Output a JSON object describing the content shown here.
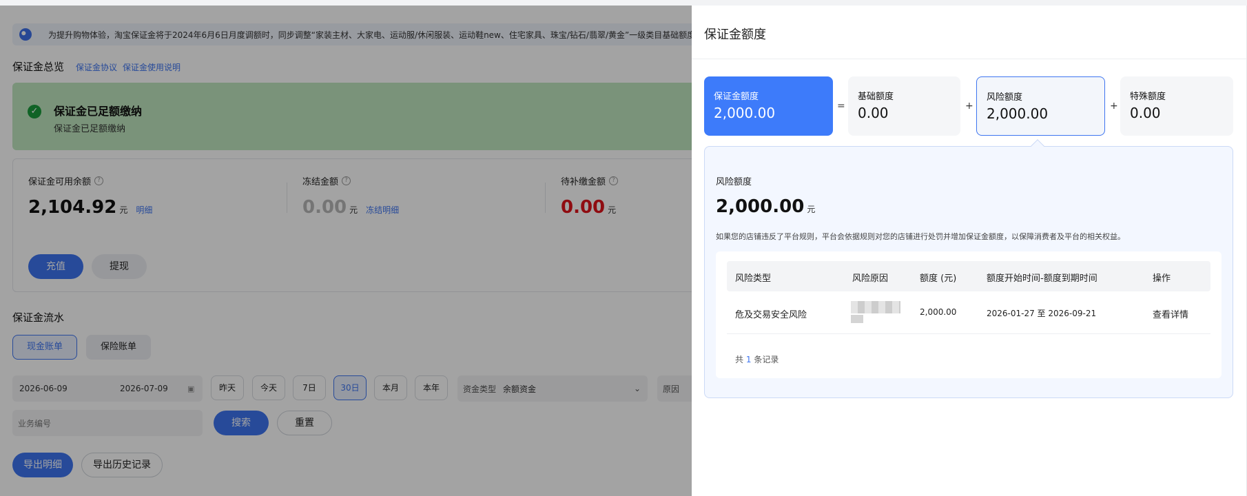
{
  "notice": {
    "text": "为提升购物体验，淘宝保证金将于2024年6月6日月度调额时，同步调整“家装主材、大家电、运动服/休闲服装、运动鞋new、住宅家具、珠宝/钻石/翡翠/黄金”一级类目基础额度，"
  },
  "overview": {
    "title": "保证金总览",
    "links": [
      "保证金协议",
      "保证金使用说明"
    ]
  },
  "status": {
    "title": "保证金已足额缴纳",
    "subtitle": "保证金已足额缴纳"
  },
  "balances": [
    {
      "label": "保证金可用余额",
      "value": "2,104.92",
      "unit": "元",
      "link": "明细",
      "color": "#111111"
    },
    {
      "label": "冻结金额",
      "value": "0.00",
      "unit": "元",
      "link": "冻结明细",
      "color": "#b8b8b8"
    },
    {
      "label": "待补缴金额",
      "value": "0.00",
      "unit": "元",
      "link": "",
      "color": "#e0141c"
    }
  ],
  "balance_actions": {
    "recharge": "充值",
    "withdraw": "提现"
  },
  "flow": {
    "title": "保证金流水",
    "tabs": [
      "现金账单",
      "保险账单"
    ],
    "date_start": "2026-06-09",
    "date_end": "2026-07-09",
    "quick_dates": [
      "昨天",
      "今天",
      "7日",
      "30日",
      "本月",
      "本年"
    ],
    "fund_type_label": "资金类型",
    "fund_type_value": "余额资金",
    "reason_label": "原因",
    "business_no_placeholder": "业务编号",
    "search": "搜索",
    "reset": "重置",
    "export": "导出明细",
    "export_history": "导出历史记录"
  },
  "drawer": {
    "title": "保证金额度",
    "quotas": [
      {
        "label": "保证金额度",
        "value": "2,000.00"
      },
      {
        "label": "基础额度",
        "value": "0.00"
      },
      {
        "label": "风险额度",
        "value": "2,000.00"
      },
      {
        "label": "特殊额度",
        "value": "0.00"
      }
    ],
    "operators": [
      "=",
      "+",
      "+"
    ],
    "detail": {
      "label": "风险额度",
      "value": "2,000.00",
      "unit": "元",
      "description": "如果您的店铺违反了平台规则，平台会依据规则对您的店铺进行处罚并增加保证金额度，以保障消费者及平台的相关权益。"
    },
    "table": {
      "headers": [
        "风险类型",
        "风险原因",
        "额度 (元)",
        "额度开始时间-额度到期时间",
        "操作"
      ],
      "rows": [
        {
          "type": "危及交易安全风险",
          "amount": "2,000.00",
          "period": "2026-01-27 至 2026-09-21",
          "action": "查看详情"
        }
      ],
      "total_prefix": "共",
      "total_count": "1",
      "total_suffix": "条记录"
    }
  },
  "colors": {
    "accent": "#3d74f0",
    "success_bg": "#bfe7bf",
    "success_icon": "#1a9b3c",
    "danger": "#e0141c"
  }
}
